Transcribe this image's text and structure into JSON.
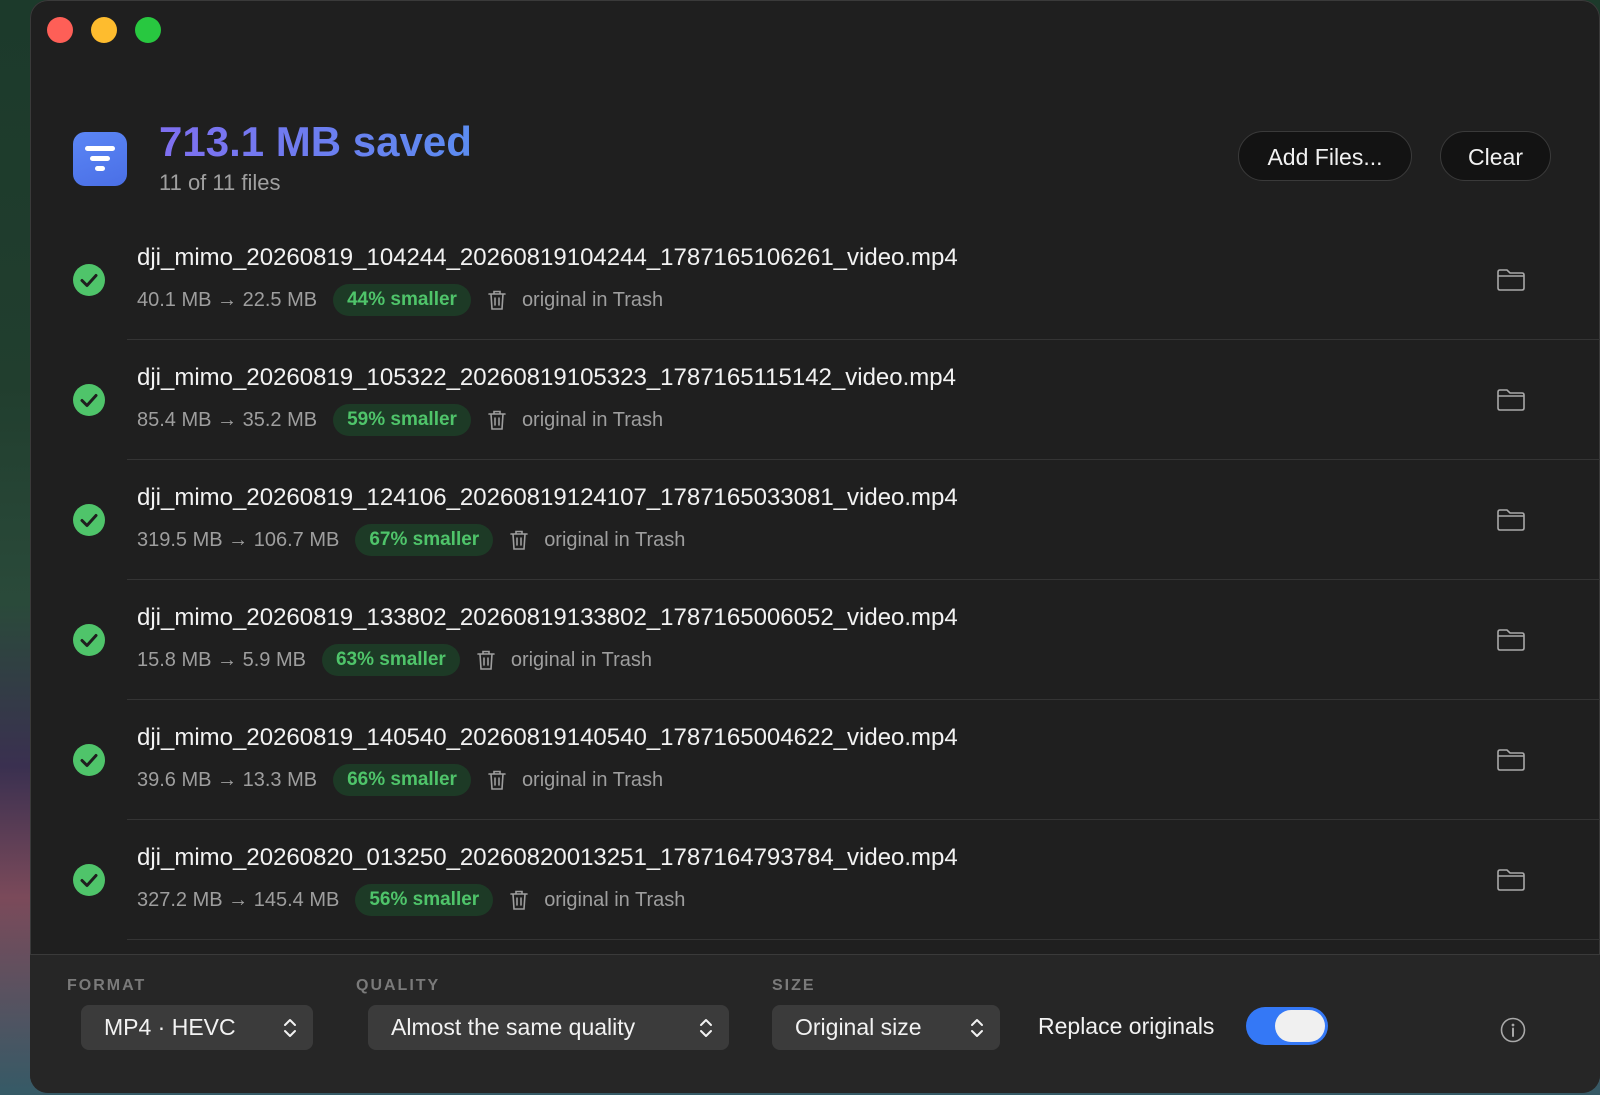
{
  "header": {
    "title": "713.1 MB saved",
    "subtitle": "11 of 11 files",
    "add_files_label": "Add Files...",
    "clear_label": "Clear"
  },
  "files": [
    {
      "name": "dji_mimo_20260819_104244_20260819104244_1787165106261_video.mp4",
      "sizes": "40.1 MB → 22.5 MB",
      "badge": "44% smaller",
      "trash_note": "original in Trash"
    },
    {
      "name": "dji_mimo_20260819_105322_20260819105323_1787165115142_video.mp4",
      "sizes": "85.4 MB → 35.2 MB",
      "badge": "59% smaller",
      "trash_note": "original in Trash"
    },
    {
      "name": "dji_mimo_20260819_124106_20260819124107_1787165033081_video.mp4",
      "sizes": "319.5 MB → 106.7 MB",
      "badge": "67% smaller",
      "trash_note": "original in Trash"
    },
    {
      "name": "dji_mimo_20260819_133802_20260819133802_1787165006052_video.mp4",
      "sizes": "15.8 MB → 5.9 MB",
      "badge": "63% smaller",
      "trash_note": "original in Trash"
    },
    {
      "name": "dji_mimo_20260819_140540_20260819140540_1787165004622_video.mp4",
      "sizes": "39.6 MB → 13.3 MB",
      "badge": "66% smaller",
      "trash_note": "original in Trash"
    },
    {
      "name": "dji_mimo_20260820_013250_20260820013251_1787164793784_video.mp4",
      "sizes": "327.2 MB → 145.4 MB",
      "badge": "56% smaller",
      "trash_note": "original in Trash"
    }
  ],
  "bottom": {
    "format_label": "FORMAT",
    "format_value": "MP4 · HEVC",
    "quality_label": "QUALITY",
    "quality_value": "Almost the same quality",
    "size_label": "SIZE",
    "size_value": "Original size",
    "replace_label": "Replace originals",
    "replace_on": true
  },
  "colors": {
    "accent": "#3478f6",
    "success": "#4fc46a",
    "title_gradient_start": "#7f6ff0",
    "title_gradient_end": "#5b8cf0"
  }
}
